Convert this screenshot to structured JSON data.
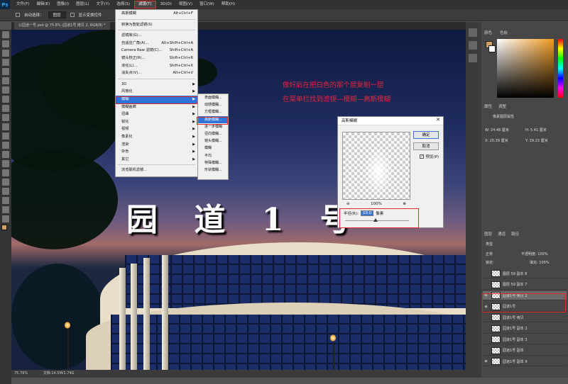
{
  "app": {
    "logo": "Ps"
  },
  "menubar": {
    "items": [
      "文件(F)",
      "编辑(E)",
      "图像(I)",
      "图层(L)",
      "文字(Y)",
      "选择(S)",
      "滤镜(T)",
      "3D(D)",
      "视图(V)",
      "窗口(W)",
      "帮助(H)"
    ],
    "active_index": 6
  },
  "options_bar": {
    "auto_select_label": "自动选择：",
    "auto_select_value": "图层",
    "show_transform_label": "显示变换控件"
  },
  "document_tab": {
    "title": "公园道一号.psd @ 75.8% (园道1号 拷贝 2, RGB/8) *"
  },
  "canvas": {
    "big_title": "园 道 1 号",
    "annotation_line1": "做好后在把白色的那个层复制一层",
    "annotation_line2": "在菜单栏找到滤镜—模糊—高斯模糊"
  },
  "filter_menu": {
    "items": [
      {
        "label": "高斯模糊",
        "shortcut": "Alt+Ctrl+F"
      },
      {
        "label": "---"
      },
      {
        "label": "转换为智能滤镜(S)"
      },
      {
        "label": "---"
      },
      {
        "label": "滤镜库(G)..."
      },
      {
        "label": "自适应广角(A)...",
        "shortcut": "Alt+Shift+Ctrl+A"
      },
      {
        "label": "Camera Raw 滤镜(C)...",
        "shortcut": "Shift+Ctrl+A"
      },
      {
        "label": "镜头校正(R)...",
        "shortcut": "Shift+Ctrl+R"
      },
      {
        "label": "液化(L)...",
        "shortcut": "Shift+Ctrl+X"
      },
      {
        "label": "消失点(V)...",
        "shortcut": "Alt+Ctrl+V"
      },
      {
        "label": "---"
      },
      {
        "label": "3D",
        "submenu": true
      },
      {
        "label": "风格化",
        "submenu": true
      },
      {
        "label": "模糊",
        "submenu": true,
        "highlighted": true
      },
      {
        "label": "模糊画廊",
        "submenu": true
      },
      {
        "label": "扭曲",
        "submenu": true
      },
      {
        "label": "锐化",
        "submenu": true
      },
      {
        "label": "视频",
        "submenu": true
      },
      {
        "label": "像素化",
        "submenu": true
      },
      {
        "label": "渲染",
        "submenu": true
      },
      {
        "label": "杂色",
        "submenu": true
      },
      {
        "label": "其它",
        "submenu": true
      },
      {
        "label": "---"
      },
      {
        "label": "浏览联机滤镜..."
      }
    ]
  },
  "blur_submenu": {
    "items": [
      {
        "label": "表面模糊..."
      },
      {
        "label": "动感模糊..."
      },
      {
        "label": "方框模糊..."
      },
      {
        "label": "高斯模糊...",
        "highlighted": true
      },
      {
        "label": "进一步模糊"
      },
      {
        "label": "径向模糊..."
      },
      {
        "label": "镜头模糊..."
      },
      {
        "label": "模糊"
      },
      {
        "label": "平均"
      },
      {
        "label": "特殊模糊..."
      },
      {
        "label": "形状模糊..."
      }
    ]
  },
  "gauss_dialog": {
    "title": "高斯模糊",
    "ok_label": "确定",
    "cancel_label": "取消",
    "preview_label": "预览(P)",
    "zoom_value": "100%",
    "radius_label": "半径(R):",
    "radius_value": "10.0",
    "radius_unit": "像素"
  },
  "right_panels": {
    "color_tab": "颜色",
    "swatches_tab": "色板",
    "properties_tab": "属性",
    "adjust_tab": "调整",
    "props_title": "像素图层属性",
    "w_value": "W: 24.48 厘米",
    "h_value": "H: 5.41 厘米",
    "x_value": "X: 20.39 厘米",
    "y_value": "Y: 39.23 厘米",
    "layers_tab": "图层",
    "channels_tab": "通道",
    "paths_tab": "路径",
    "kind_label": "类型",
    "blend_mode": "正常",
    "opacity_label": "不透明度: 100%",
    "lock_label": "锁定:",
    "fill_label": "填充: 100%",
    "layers": [
      {
        "name": "图层 59 副本 8"
      },
      {
        "name": "图层 59 副本 7"
      },
      {
        "name": "园道1号 拷贝 2",
        "selected": true
      },
      {
        "name": "园道1号"
      },
      {
        "name": "园道1号 拷贝"
      },
      {
        "name": "园道1号 副本 2"
      },
      {
        "name": "园道1号 副本 3"
      },
      {
        "name": "园道1号 副本"
      },
      {
        "name": "园道1号 副本 9"
      }
    ]
  },
  "status": {
    "zoom": "75.79%",
    "doc": "文档:14.5M/1.74G"
  },
  "colors": {
    "accent_red": "#e02a2a",
    "menu_highlight": "#2e74d8",
    "annotation": "#e0283c",
    "fg_swatch": "#d4a060"
  }
}
